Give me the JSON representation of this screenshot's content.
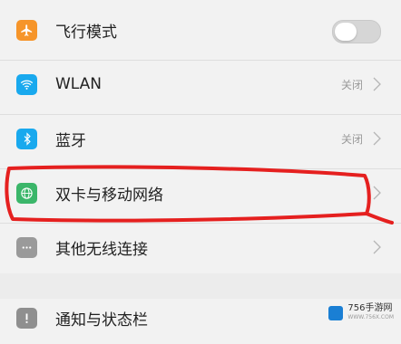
{
  "settings": {
    "airplane": {
      "label": "飞行模式",
      "toggle_on": false,
      "icon": "airplane-icon",
      "color": "#f6952a"
    },
    "wlan": {
      "label": "WLAN",
      "value": "关闭",
      "icon": "wifi-icon",
      "color": "#19a9ee"
    },
    "bluetooth": {
      "label": "蓝牙",
      "value": "关闭",
      "icon": "bluetooth-icon",
      "color": "#19a9ee"
    },
    "dualsim": {
      "label": "双卡与移动网络",
      "icon": "globe-icon",
      "color": "#3bb66a"
    },
    "wireless": {
      "label": "其他无线连接",
      "icon": "more-icon",
      "color": "#9a9a9a"
    },
    "notifications": {
      "label": "通知与状态栏",
      "icon": "exclamation-icon",
      "color": "#8f8f8f"
    }
  },
  "watermark": {
    "title": "756手游网",
    "url": "WWW.756X.COM"
  }
}
